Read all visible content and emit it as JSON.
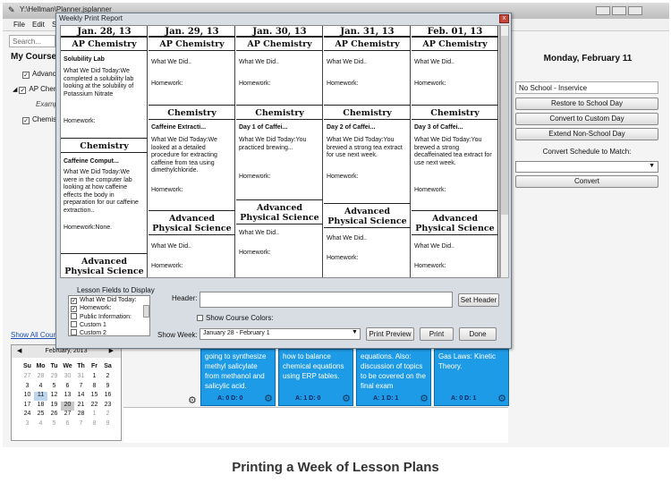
{
  "app": {
    "title": "Y:\\Hellman\\Planner.jsplanner",
    "menu": [
      "File",
      "Edit",
      "S"
    ],
    "search_placeholder": "Search...",
    "my_courses": "My Course",
    "courses": [
      {
        "label": "Advance",
        "checked": "✓"
      },
      {
        "label": "AP Cher",
        "checked": "✓"
      },
      {
        "label": "Examp",
        "checked": ""
      },
      {
        "label": "Chemist",
        "checked": "✓"
      }
    ],
    "show_all": "Show All Cour",
    "calendar": {
      "month": "February, 2013",
      "weekdays": [
        "Su",
        "Mo",
        "Tu",
        "We",
        "Th",
        "Fr",
        "Sa"
      ],
      "weeks": [
        [
          "27",
          "28",
          "29",
          "30",
          "31",
          "1",
          "2"
        ],
        [
          "3",
          "4",
          "5",
          "6",
          "7",
          "8",
          "9"
        ],
        [
          "10",
          "11",
          "12",
          "13",
          "14",
          "15",
          "16"
        ],
        [
          "17",
          "18",
          "19",
          "20",
          "21",
          "22",
          "23"
        ],
        [
          "24",
          "25",
          "26",
          "27",
          "28",
          "1",
          "2"
        ],
        [
          "3",
          "4",
          "5",
          "6",
          "7",
          "8",
          "9"
        ]
      ]
    },
    "right_panel": {
      "day_title": "Monday, February 11",
      "no_school_value": "No School - Inservice",
      "buttons": [
        "Restore to School Day",
        "Convert to Custom Day",
        "Extend Non-School Day"
      ],
      "convert_label": "Convert Schedule to Match:",
      "convert_button": "Convert"
    },
    "tiles": [
      {
        "text": "going to synthesize methyl salicylate from methanol and salicylic acid.",
        "att": "A: 0 D: 0"
      },
      {
        "text": "how to balance chemical equations using ERP tables.",
        "att": "A: 1 D: 0"
      },
      {
        "text": "equations. Also: discussion of topics to be covered on the final exam",
        "att": "A: 1 D: 1"
      },
      {
        "text": "Gas Laws: Kinetic Theory.",
        "att": "A: 0 D: 1"
      }
    ]
  },
  "dialog": {
    "title": "Weekly Print Report",
    "close": "x",
    "days": [
      {
        "date": "Jan. 28, 13",
        "sections": [
          {
            "course": "AP Chemistry",
            "subtitle": "Solubility Lab",
            "did": "What We Did Today:We completed a solubility lab looking at the solubility of Potassium Nitrate",
            "homework": "Homework:"
          },
          {
            "course": "Chemistry",
            "subtitle": "Caffeine Comput...",
            "did": "What We Did Today:We were in the computer lab looking at how caffeine effects the body in preparation for our caffeine extraction..",
            "homework": "Homework:None."
          },
          {
            "course": "Advanced Physical Science",
            "subtitle": "",
            "did": "",
            "homework": ""
          }
        ]
      },
      {
        "date": "Jan. 29, 13",
        "sections": [
          {
            "course": "AP Chemistry",
            "subtitle": "",
            "did": "What We Did..",
            "homework": "Homework:"
          },
          {
            "course": "Chemistry",
            "subtitle": "Caffeine Extracti...",
            "did": "What We Did Today:We looked at a detailed procedure for extracting caffeine from tea using dimethylchloride.",
            "homework": "Homework:"
          },
          {
            "course": "Advanced Physical Science",
            "subtitle": "",
            "did": "What We Did..",
            "homework": "Homework:"
          }
        ]
      },
      {
        "date": "Jan. 30, 13",
        "sections": [
          {
            "course": "AP Chemistry",
            "subtitle": "",
            "did": "What We Did..",
            "homework": "Homework:"
          },
          {
            "course": "Chemistry",
            "subtitle": "Day 1 of Caffei...",
            "did": "What We Did Today:You practiced brewing...",
            "homework": "Homework:"
          },
          {
            "course": "Advanced Physical Science",
            "subtitle": "",
            "did": "What We Did..",
            "homework": "Homework:"
          }
        ]
      },
      {
        "date": "Jan. 31, 13",
        "sections": [
          {
            "course": "AP Chemistry",
            "subtitle": "",
            "did": "What We Did..",
            "homework": "Homework:"
          },
          {
            "course": "Chemistry",
            "subtitle": "Day 2 of Caffei...",
            "did": "What We Did Today:You brewed a strong tea extract for use next week.",
            "homework": "Homework:"
          },
          {
            "course": "Advanced Physical Science",
            "subtitle": "",
            "did": "What We Did..",
            "homework": "Homework:"
          }
        ]
      },
      {
        "date": "Feb. 01, 13",
        "sections": [
          {
            "course": "AP Chemistry",
            "subtitle": "",
            "did": "What We Did..",
            "homework": "Homework:"
          },
          {
            "course": "Chemistry",
            "subtitle": "Day 3 of Caffei...",
            "did": "What We Did Today:You brewed a strong decaffeinated tea extract for use next week.",
            "homework": "Homework:"
          },
          {
            "course": "Advanced Physical Science",
            "subtitle": "",
            "did": "What We Did..",
            "homework": "Homework:"
          }
        ]
      }
    ],
    "fields_label": "Lesson Fields to Display",
    "fields": [
      {
        "label": "What We Did Today:",
        "checked": "✓"
      },
      {
        "label": "Homework:",
        "checked": "✓"
      },
      {
        "label": "Public Information:",
        "checked": ""
      },
      {
        "label": "Custom 1",
        "checked": ""
      },
      {
        "label": "Custom 2",
        "checked": ""
      }
    ],
    "header_label": "Header:",
    "header_value": "",
    "set_header": "Set Header",
    "show_colors": "Show Course Colors:",
    "show_week_label": "Show Week:",
    "show_week_value": "January 28 - February 1",
    "print_preview": "Print Preview",
    "print": "Print",
    "done": "Done"
  },
  "caption": "Printing a Week of Lesson Plans"
}
